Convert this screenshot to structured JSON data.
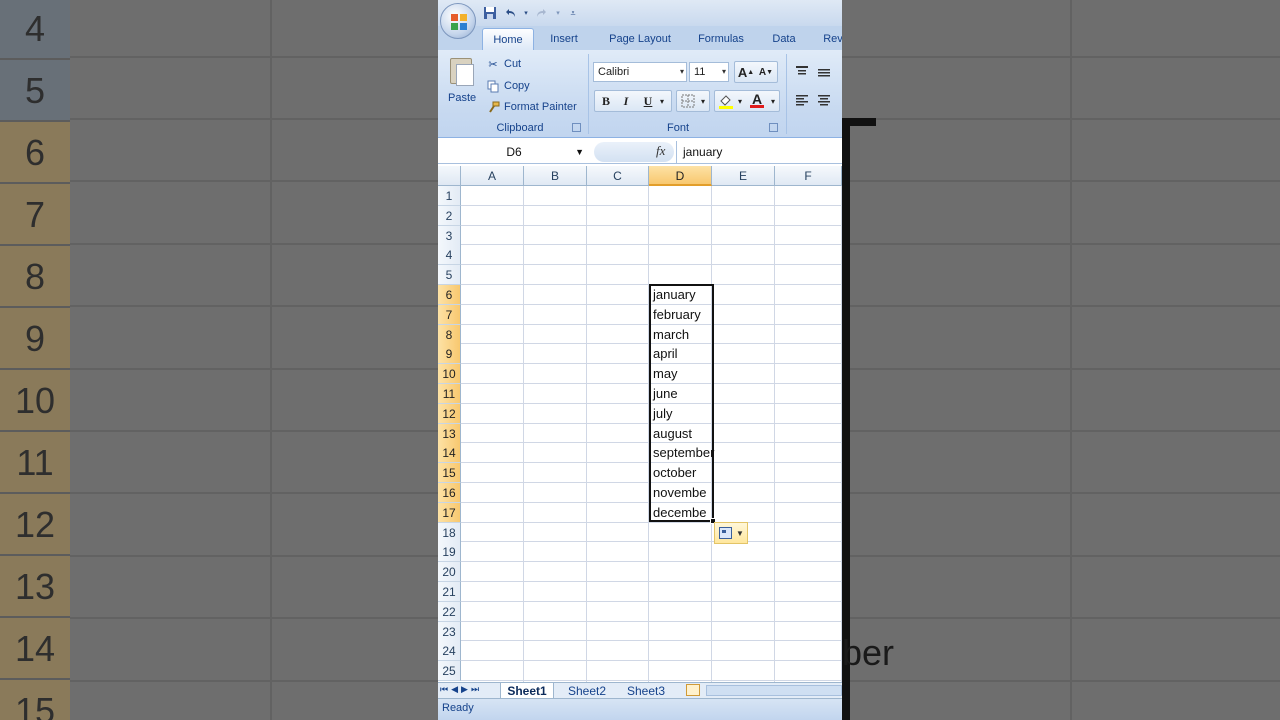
{
  "background": {
    "rows": [
      "4",
      "5",
      "6",
      "7",
      "8",
      "9",
      "10",
      "11",
      "12",
      "13",
      "14",
      "15"
    ],
    "partial_text": "ber"
  },
  "titlebar": {
    "qat": [
      "save-icon",
      "undo-icon",
      "redo-icon",
      "customize-qat-icon"
    ]
  },
  "tabs": [
    "Home",
    "Insert",
    "Page Layout",
    "Formulas",
    "Data",
    "Rev"
  ],
  "ribbon": {
    "clipboard": {
      "paste": "Paste",
      "cut": "Cut",
      "copy": "Copy",
      "format_painter": "Format Painter",
      "label": "Clipboard"
    },
    "font": {
      "family": "Calibri",
      "size": "11",
      "bold": "B",
      "italic": "I",
      "underline": "U",
      "grow": "A",
      "shrink": "A",
      "font_color_glyph": "A",
      "label": "Font"
    }
  },
  "formula_bar": {
    "name_box": "D6",
    "fx": "fx",
    "value": "january"
  },
  "grid": {
    "columns": [
      "A",
      "B",
      "C",
      "D",
      "E",
      "F"
    ],
    "selected_column": "D",
    "rows": [
      "1",
      "2",
      "3",
      "4",
      "5",
      "6",
      "7",
      "8",
      "9",
      "10",
      "11",
      "12",
      "13",
      "14",
      "15",
      "16",
      "17",
      "18",
      "19",
      "20",
      "21",
      "22",
      "23",
      "24",
      "25"
    ],
    "selected_rows": [
      "6",
      "7",
      "8",
      "9",
      "10",
      "11",
      "12",
      "13",
      "14",
      "15",
      "16",
      "17"
    ],
    "cells_D": [
      "january",
      "february",
      "march",
      "april",
      "may",
      "june",
      "july",
      "august",
      "september",
      "october",
      "novembe",
      "decembe"
    ]
  },
  "sheets": [
    "Sheet1",
    "Sheet2",
    "Sheet3"
  ],
  "active_sheet": "Sheet1",
  "status": "Ready",
  "colors": {
    "selection_header": "#f8c86f",
    "ribbon_text": "#15428b"
  }
}
